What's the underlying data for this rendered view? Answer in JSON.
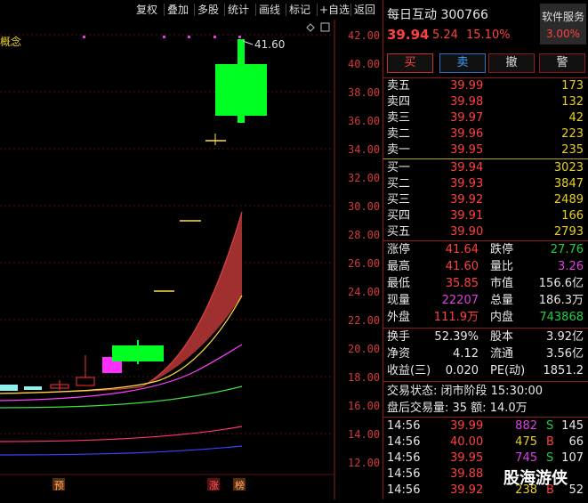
{
  "toolbar": {
    "items": [
      "复权",
      "叠加",
      "多股",
      "统计",
      "画线",
      "标记",
      "+自选",
      "返回"
    ]
  },
  "chart": {
    "left_label": "概念",
    "price_ticks": [
      "42.00",
      "40.00",
      "38.00",
      "36.00",
      "34.00",
      "32.00",
      "30.00",
      "28.00",
      "26.00",
      "24.00",
      "22.00",
      "20.00",
      "18.00",
      "16.00",
      "14.00",
      "12.00"
    ],
    "high_annotation": "41.60",
    "bottom_markers": [
      "预",
      "涨",
      "榜"
    ],
    "colors": {
      "up": "#00ff22",
      "down": "#ff2020",
      "axis": "#d23a3a"
    }
  },
  "quote": {
    "name": "每日互动",
    "code": "300766",
    "price": "39.94",
    "change": "5.24",
    "change_pct": "15.10%",
    "service_label": "软件服务",
    "service_pct": "3.00%"
  },
  "actions": {
    "buy": "买",
    "sell": "卖",
    "cancel": "撤",
    "alert": "警"
  },
  "asks": [
    {
      "label": "卖五",
      "price": "39.99",
      "vol": "173"
    },
    {
      "label": "卖四",
      "price": "39.98",
      "vol": "132"
    },
    {
      "label": "卖三",
      "price": "39.97",
      "vol": "42"
    },
    {
      "label": "卖二",
      "price": "39.96",
      "vol": "223"
    },
    {
      "label": "卖一",
      "price": "39.95",
      "vol": "235"
    }
  ],
  "bids": [
    {
      "label": "买一",
      "price": "39.94",
      "vol": "3023"
    },
    {
      "label": "买二",
      "price": "39.93",
      "vol": "3847"
    },
    {
      "label": "买三",
      "price": "39.92",
      "vol": "2489"
    },
    {
      "label": "买四",
      "price": "39.91",
      "vol": "166"
    },
    {
      "label": "买五",
      "price": "39.90",
      "vol": "2793"
    }
  ],
  "stats1": [
    {
      "l1": "涨停",
      "v1": "41.64",
      "c1": "red",
      "l2": "跌停",
      "v2": "27.76",
      "c2": "green"
    },
    {
      "l1": "最高",
      "v1": "41.60",
      "c1": "red",
      "l2": "量比",
      "v2": "3.26",
      "c2": "mag"
    },
    {
      "l1": "最低",
      "v1": "35.85",
      "c1": "red",
      "l2": "市值",
      "v2": "156.6亿",
      "c2": "white"
    },
    {
      "l1": "现量",
      "v1": "22207",
      "c1": "mag",
      "l2": "总量",
      "v2": "186.3万",
      "c2": "white"
    },
    {
      "l1": "外盘",
      "v1": "111.9万",
      "c1": "red",
      "l2": "内盘",
      "v2": "743868",
      "c2": "green"
    }
  ],
  "stats2": [
    {
      "l1": "换手",
      "v1": "52.39%",
      "l2": "股本",
      "v2": "3.92亿"
    },
    {
      "l1": "净资",
      "v1": "4.12",
      "l2": "流通",
      "v2": "3.56亿"
    },
    {
      "l1": "收益(三)",
      "v1": "0.020",
      "l2": "PE(动)",
      "v2": "1851.2"
    }
  ],
  "status": {
    "line1": "交易状态: 闭市阶段 15:30:00",
    "line2": "盘后交易量: 35  额: 14.0万"
  },
  "ticks": [
    {
      "time": "14:56",
      "price": "39.99",
      "pc": "red",
      "vol": "882",
      "vc": "mag",
      "side": "S",
      "sc": "green",
      "n": "145"
    },
    {
      "time": "14:56",
      "price": "40.00",
      "pc": "red",
      "vol": "475",
      "vc": "yellow",
      "side": "B",
      "sc": "red",
      "n": "66"
    },
    {
      "time": "14:56",
      "price": "39.95",
      "pc": "red",
      "vol": "745",
      "vc": "mag",
      "side": "S",
      "sc": "green",
      "n": "107"
    },
    {
      "time": "14:56",
      "price": "39.88",
      "pc": "red",
      "vol": "",
      "vc": "white",
      "side": "",
      "sc": "red",
      "n": ""
    },
    {
      "time": "14:56",
      "price": "39.92",
      "pc": "red",
      "vol": "238",
      "vc": "yellow",
      "side": "B",
      "sc": "red",
      "n": "52"
    }
  ],
  "watermark": "股海游侠"
}
